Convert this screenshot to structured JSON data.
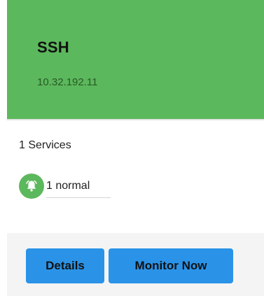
{
  "host": {
    "name": "SSH",
    "ip": "10.32.192.11",
    "status_color": "#5cb85c"
  },
  "services": {
    "count_label": "1 Services",
    "status_icon": "bell-icon",
    "status_label": "1 normal"
  },
  "actions": {
    "details_label": "Details",
    "monitor_label": "Monitor Now",
    "button_color": "#2a93e8"
  }
}
